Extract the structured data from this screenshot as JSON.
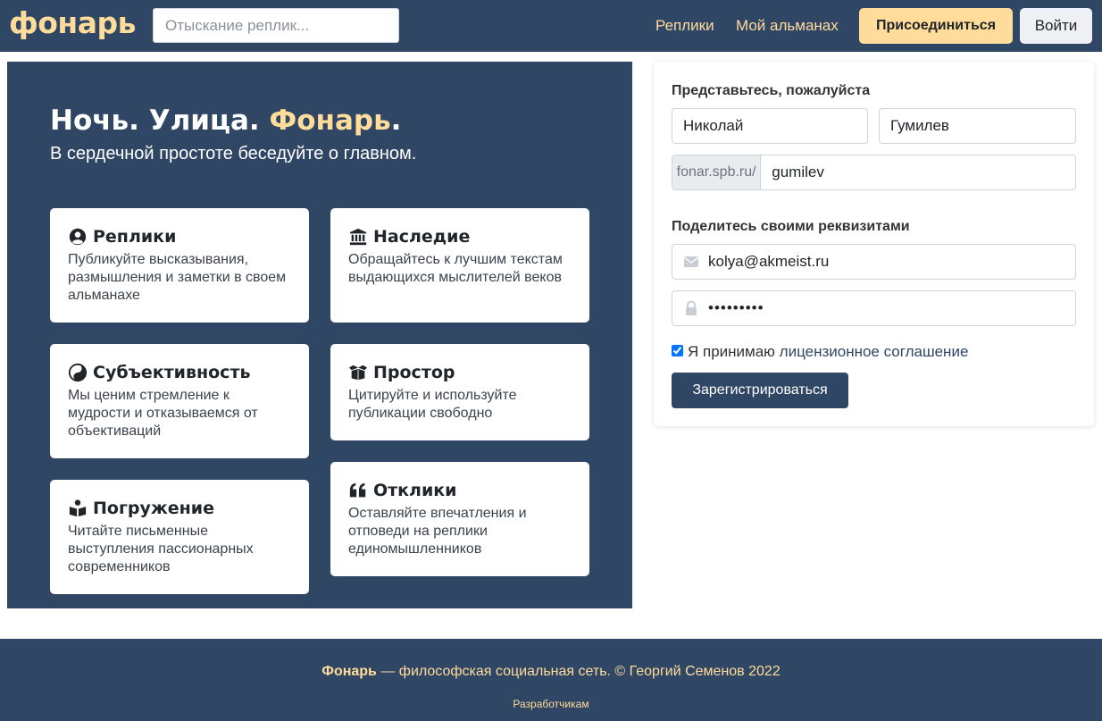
{
  "colors": {
    "primary": "#304665",
    "accent": "#ffdc9a",
    "white": "#ffffff"
  },
  "navbar": {
    "brand": "фонарь",
    "search_placeholder": "Отыскание реплик...",
    "links": [
      "Реплики",
      "Мой альманах"
    ],
    "join_label": "Присоединиться",
    "login_label": "Войти"
  },
  "hero": {
    "title_part1": "Ночь. Улица. ",
    "title_accent": "Фонарь",
    "title_end": ".",
    "subtitle": "В сердечной простоте беседуйте о главном.",
    "features": [
      {
        "icon": "user-circle-icon",
        "title": "Реплики",
        "text": "Публикуйте высказывания, размышления и заметки в своем альманахе"
      },
      {
        "icon": "landmark-icon",
        "title": "Наследие",
        "text": "Обращайтесь к лучшим текстам выдающихся мыслителей веков"
      },
      {
        "icon": "yin-yang-icon",
        "title": "Субъективность",
        "text": "Мы ценим стремление к мудрости и отказываемся от объективаций"
      },
      {
        "icon": "box-open-icon",
        "title": "Простор",
        "text": "Цитируйте и используйте публикации свободно"
      },
      {
        "icon": "book-reader-icon",
        "title": "Погружение",
        "text": "Читайте письменные выступления пассионарных современников"
      },
      {
        "icon": "quote-left-icon",
        "title": "Отклики",
        "text": "Оставляйте впечатления и отповеди на реплики единомышленников"
      }
    ]
  },
  "form": {
    "intro_label": "Представьтесь, пожалуйста",
    "first_name": "Николай",
    "last_name": "Гумилев",
    "url_prefix": "fonar.spb.ru/",
    "username": "gumilev",
    "credentials_label": "Поделитесь своими реквизитами",
    "email": "kolya@akmeist.ru",
    "password": "•••••••••",
    "agree_text": "Я принимаю ",
    "agree_link": "лицензионное соглашение",
    "agree_checked": true,
    "submit_label": "Зарегистрироваться"
  },
  "footer": {
    "brand": "Фонарь",
    "tagline": " — философская социальная сеть. © Георгий Семенов 2022",
    "dev_link": "Разработчикам"
  }
}
